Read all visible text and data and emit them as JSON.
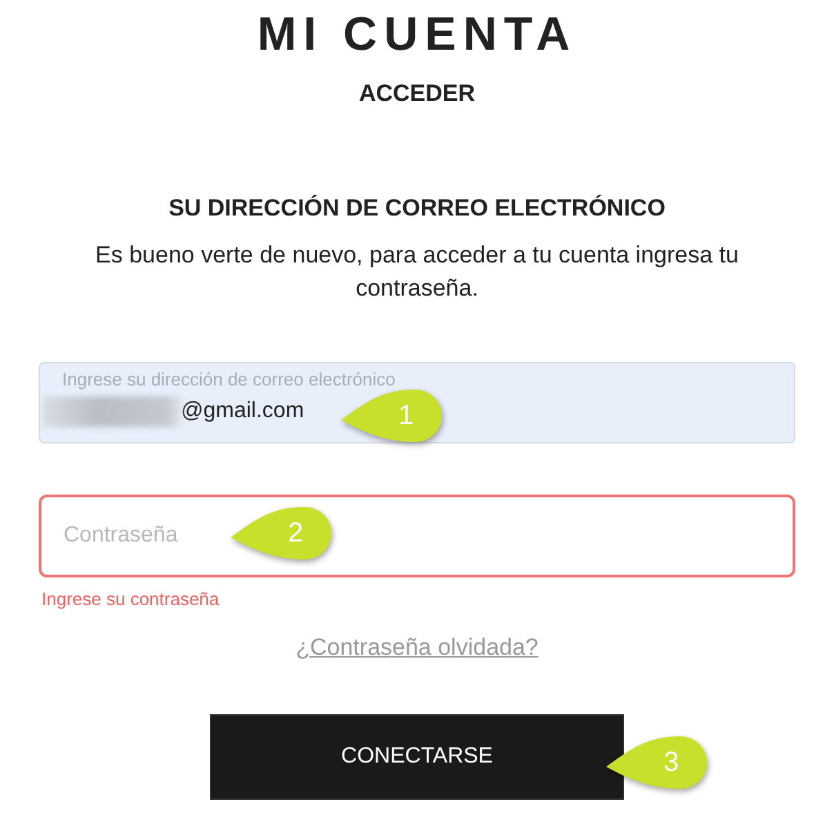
{
  "title": "MI CUENTA",
  "subtitle": "ACCEDER",
  "section_heading": "SU DIRECCIÓN DE CORREO ELECTRÓNICO",
  "intro": "Es bueno verte de nuevo, para acceder a tu cuenta ingresa tu contraseña.",
  "email_field": {
    "label": "Ingrese su dirección de correo electrónico",
    "value": "@gmail.com",
    "redacted": true,
    "callout": "1"
  },
  "password_field": {
    "placeholder": "Contraseña",
    "invalid": true,
    "error": "Ingrese su contraseña",
    "callout": "2"
  },
  "forgot_link": "¿Contraseña olvidada?",
  "submit_button": {
    "label": "CONECTARSE",
    "callout": "3"
  }
}
